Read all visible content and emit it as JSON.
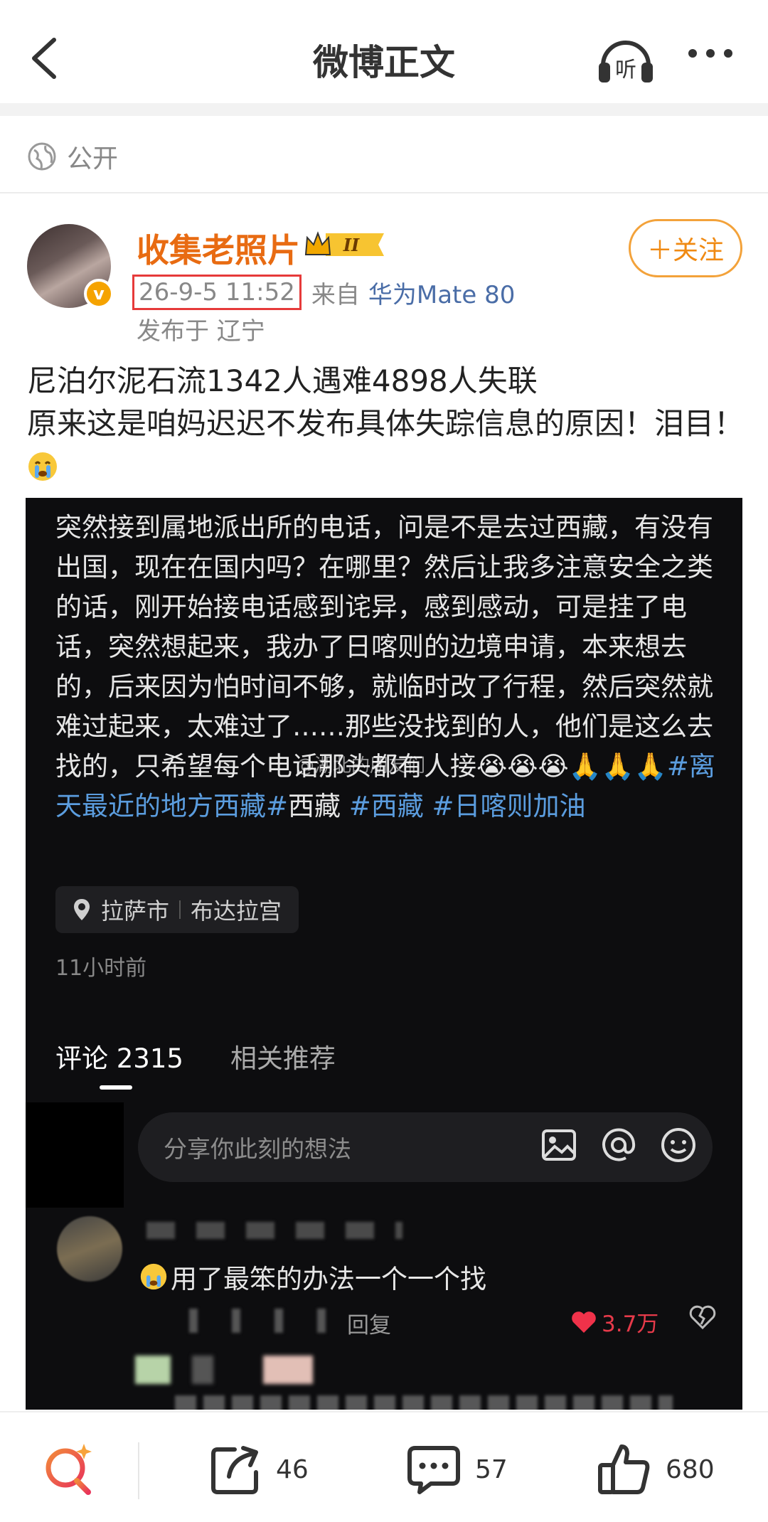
{
  "header": {
    "title": "微博正文"
  },
  "visibility": {
    "label": "公开"
  },
  "author": {
    "name": "收集老照片",
    "level_badge": "II",
    "verified_badge": "v",
    "time": "26-9-5 11:52",
    "from_label": "来自",
    "device": "华为Mate 80",
    "location": "发布于 辽宁",
    "follow_label": "＋关注"
  },
  "post": {
    "line1": "尼泊尔泥石流1342人遇难4898人失联",
    "line2": "原来这是咱妈迟迟不发布具体失踪信息的原因！泪目！"
  },
  "screenshot": {
    "body": "突然接到属地派出所的电话，问是不是去过西藏，有没有出国，现在在国内吗？在哪里？然后让我多注意安全之类的话，刚开始接电话感到诧异，感到感动，可是挂了电话，突然想起来，我办了日喀则的边境申请，本来想去的，后来因为怕时间不够，就临时改了行程，然后突然就难过起来，太难过了……那些没找到的人，他们是这么去找的，只希望每个电话那头都有人接😭😭😭🙏🙏🙏",
    "tag1": "#离天最近的地方西藏#",
    "tag_plain": "西藏",
    "tag2": " #西藏 #日喀则加油",
    "watermark": "@湖北的朋友们",
    "poi_city": "拉萨市",
    "poi_place": "布达拉宫",
    "time_ago": "11小时前",
    "tab_comments": "评论 2315",
    "tab_related": "相关推荐",
    "input_placeholder": "分享你此刻的想法",
    "comment_text": "用了最笨的办法一个一个找",
    "reply_label": "回复",
    "comment_likes": "3.7万"
  },
  "bottombar": {
    "repost_count": "46",
    "comment_count": "57",
    "like_count": "680"
  },
  "colors": {
    "accent_orange": "#e86b12",
    "link_blue": "#4a6da7",
    "tag_blue": "#5b9ddf",
    "highlight_red": "#e63a3a"
  }
}
